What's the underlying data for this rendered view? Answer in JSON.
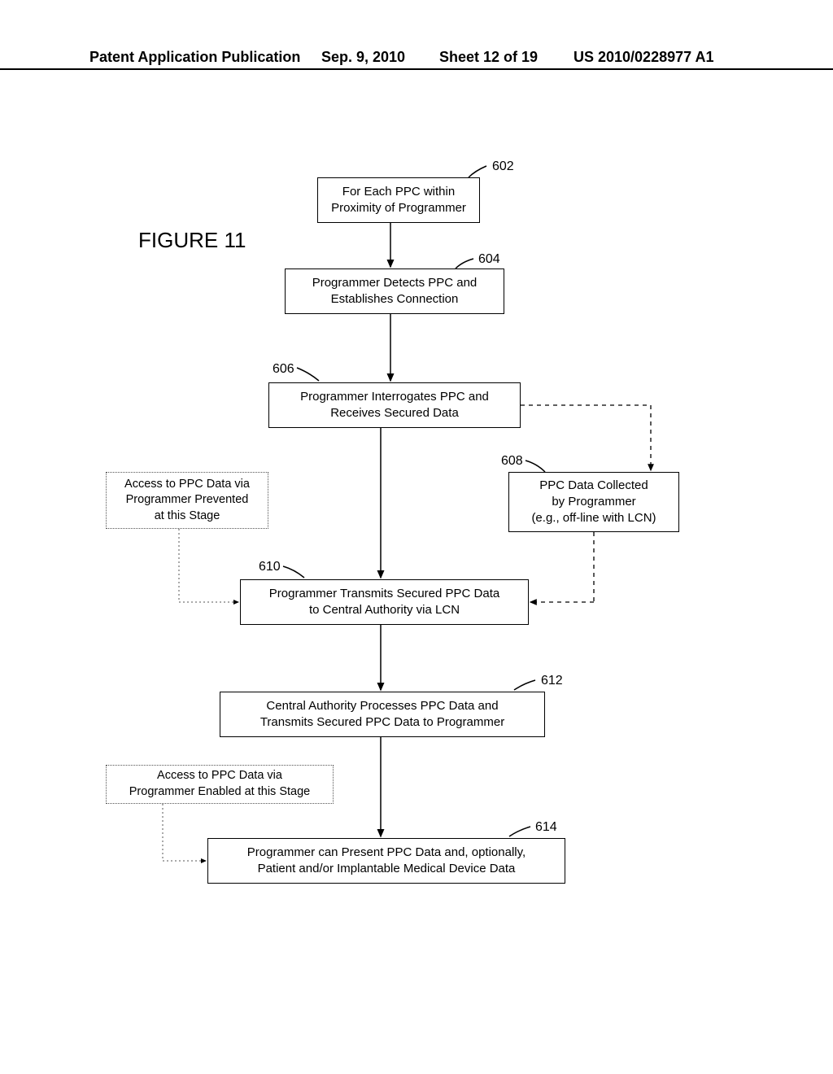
{
  "header": {
    "left": "Patent Application Publication",
    "date": "Sep. 9, 2010",
    "sheet": "Sheet 12 of 19",
    "pubno": "US 2010/0228977 A1"
  },
  "figure_title": "FIGURE 11",
  "boxes": {
    "b602": "For Each PPC within\nProximity of Programmer",
    "b604": "Programmer Detects PPC and\nEstablishes Connection",
    "b606": "Programmer Interrogates PPC and\nReceives Secured Data",
    "b608": "PPC Data Collected\nby Programmer\n(e.g., off-line with LCN)",
    "b610": "Programmer Transmits Secured PPC Data\nto Central Authority via LCN",
    "b612": "Central Authority Processes PPC Data and\nTransmits Secured PPC Data to Programmer",
    "b614": "Programmer can Present PPC Data and, optionally,\nPatient and/or Implantable Medical Device Data",
    "note1": "Access to PPC Data via\nProgrammer Prevented\nat this Stage",
    "note2": "Access to PPC Data via\nProgrammer Enabled at this Stage"
  },
  "refs": {
    "r602": "602",
    "r604": "604",
    "r606": "606",
    "r608": "608",
    "r610": "610",
    "r612": "612",
    "r614": "614"
  }
}
